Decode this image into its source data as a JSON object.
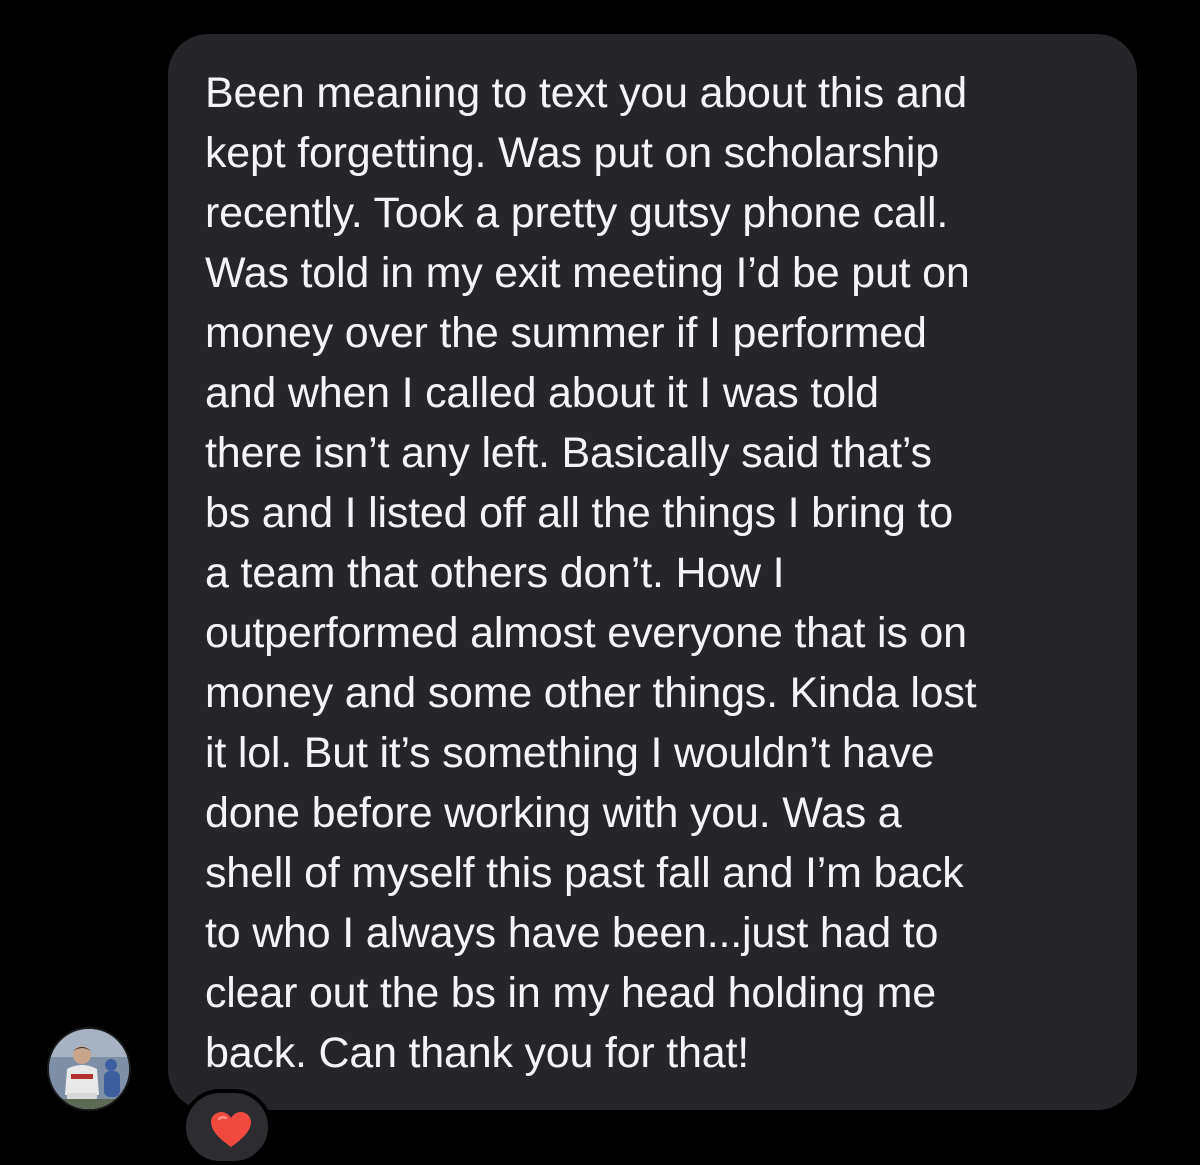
{
  "message": {
    "lines": [
      "Been meaning to text you about this and",
      "kept forgetting. Was put on scholarship",
      "recently. Took a pretty gutsy phone call.",
      "Was told in my exit meeting I’d be put on",
      "money over the summer if I performed",
      "and when I called about it I was told",
      "there isn’t any left. Basically said that’s",
      "bs and I listed off all the things I bring to",
      "a team that others don’t. How I",
      "outperformed almost everyone that is on",
      "money and some other things. Kinda lost",
      "it lol. But it’s something I wouldn’t have",
      "done before working with you. Was a",
      "shell of myself this past fall and I’m back",
      "to who I always have been...just had to",
      "clear out the bs in my head holding me",
      "back. Can thank you for that!"
    ],
    "reaction_icon": "heart-icon",
    "reaction_color": "#f0493f"
  },
  "sender": {
    "avatar_icon": "avatar-photo"
  },
  "colors": {
    "background": "#000000",
    "bubble": "#26252a",
    "text": "#f4f4f6"
  }
}
